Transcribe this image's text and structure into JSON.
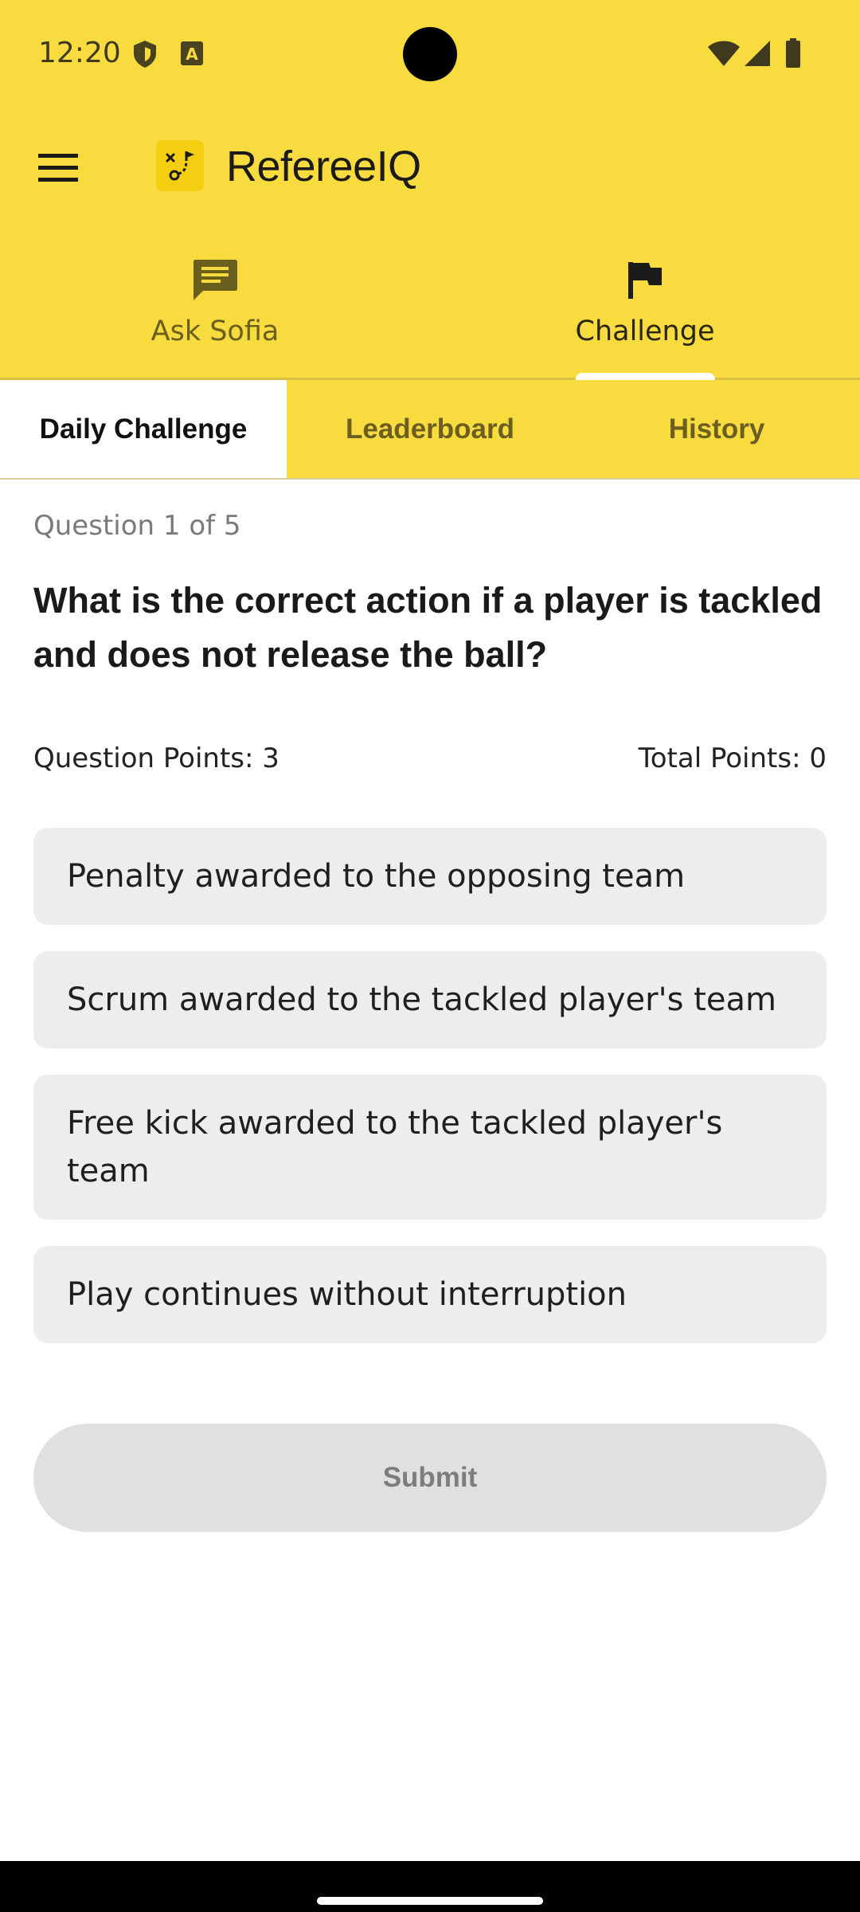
{
  "status_bar": {
    "time": "12:20",
    "icons_left": [
      "shield-icon",
      "text-a-icon"
    ],
    "icons_right": [
      "wifi-icon",
      "signal-icon",
      "battery-icon"
    ]
  },
  "app_bar": {
    "title": "RefereeIQ",
    "menu_icon": "hamburger-menu-icon",
    "logo_icon": "referee-flag-logo"
  },
  "top_tabs": [
    {
      "label": "Ask Sofia",
      "icon": "chat-icon",
      "active": false
    },
    {
      "label": "Challenge",
      "icon": "flag-icon",
      "active": true
    }
  ],
  "sub_tabs": [
    {
      "label": "Daily Challenge",
      "active": true
    },
    {
      "label": "Leaderboard",
      "active": false
    },
    {
      "label": "History",
      "active": false
    }
  ],
  "quiz": {
    "question_count": "Question 1 of 5",
    "question": "What is the correct action if a player is tackled and does not release the ball?",
    "question_points": "Question Points: 3",
    "total_points": "Total Points: 0",
    "options": [
      "Penalty awarded to the opposing team",
      "Scrum awarded to the tackled player's team",
      "Free kick awarded to the tackled player's team",
      "Play continues without interruption"
    ],
    "submit_label": "Submit"
  },
  "colors": {
    "header": "#f8db3f",
    "option_bg": "#ededed",
    "submit_bg": "#e0e0e0"
  }
}
